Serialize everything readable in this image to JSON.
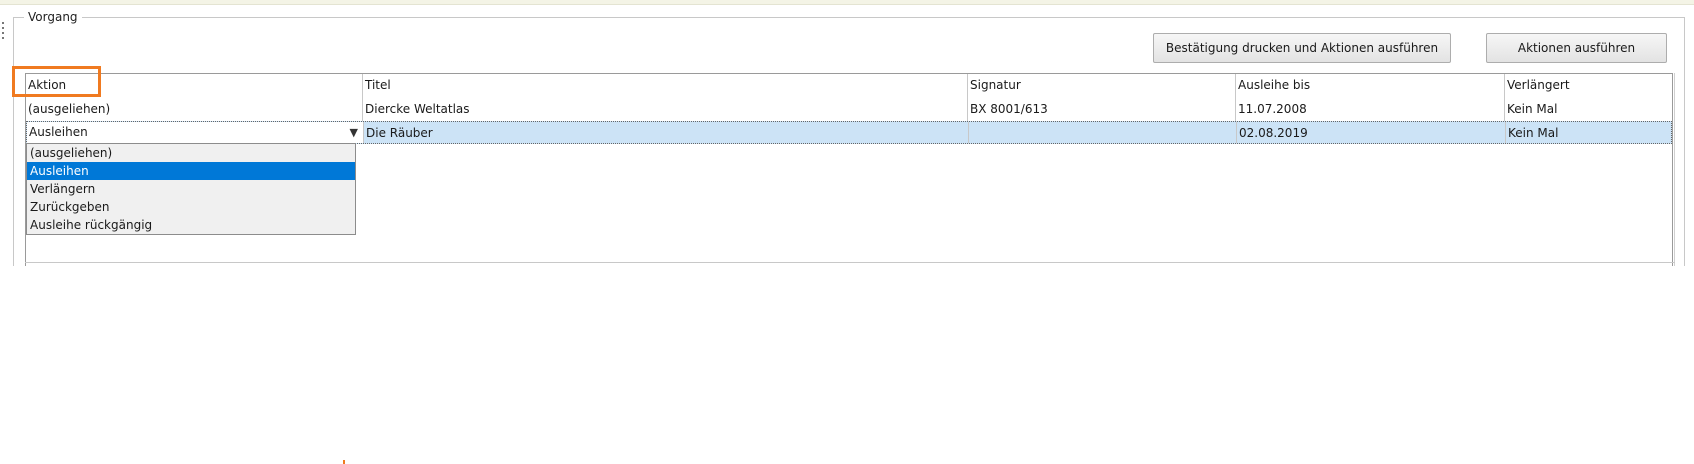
{
  "group": {
    "legend": "Vorgang"
  },
  "toolbar": {
    "print_label": "Bestätigung drucken und Aktionen ausführen",
    "run_label": "Aktionen ausführen"
  },
  "table": {
    "columns": [
      "Aktion",
      "Titel",
      "Signatur",
      "Ausleihe bis",
      "Verlängert"
    ],
    "rows": [
      {
        "aktion": "(ausgeliehen)",
        "titel": "Diercke Weltatlas",
        "signatur": "BX 8001/613",
        "ausleihe_bis": "11.07.2008",
        "verlaengert": "Kein Mal"
      },
      {
        "aktion": "Ausleihen",
        "titel": "Die Räuber",
        "signatur": "",
        "ausleihe_bis": "02.08.2019",
        "verlaengert": "Kein Mal"
      }
    ],
    "selected_row": 1
  },
  "dropdown": {
    "options": [
      "(ausgeliehen)",
      "Ausleihen",
      "Verlängern",
      "Zurückgeben",
      "Ausleihe rückgängig"
    ],
    "selected": "Ausleihen"
  },
  "colors": {
    "selection": "#0078d7",
    "row_highlight": "#cce3f6",
    "annotation": "#f07a20"
  }
}
